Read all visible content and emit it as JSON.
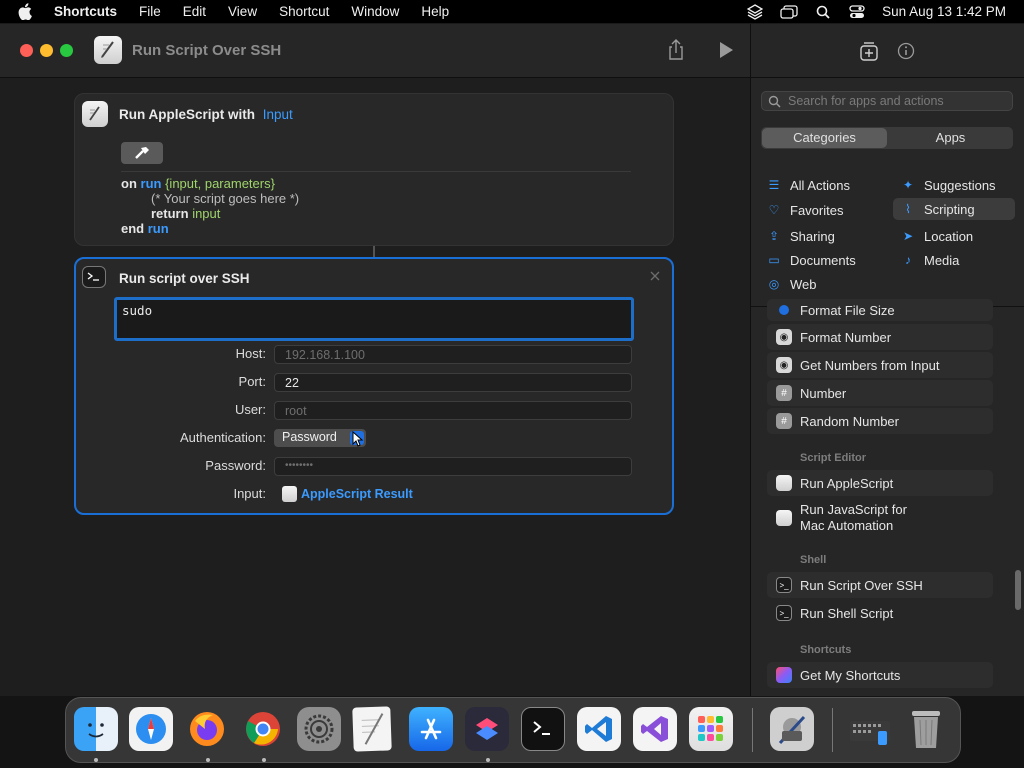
{
  "menubar": {
    "app": "Shortcuts",
    "items": [
      "File",
      "Edit",
      "View",
      "Shortcut",
      "Window",
      "Help"
    ],
    "clock": "Sun Aug 13  1:42 PM"
  },
  "window": {
    "title": "Run Script Over SSH"
  },
  "card1": {
    "title": "Run AppleScript with",
    "token": "Input",
    "code": {
      "l1_on": "on",
      "l1_run": "run",
      "l1_args": "{input, parameters}",
      "l2": "(* Your script goes here *)",
      "l3_return": "return",
      "l3_input": "input",
      "l4_end": "end",
      "l4_run": "run"
    }
  },
  "card2": {
    "title": "Run script over SSH",
    "script": "sudo",
    "host_label": "Host:",
    "host_placeholder": "192.168.1.100",
    "port_label": "Port:",
    "port_value": "22",
    "user_label": "User:",
    "user_placeholder": "root",
    "auth_label": "Authentication:",
    "auth_value": "Password",
    "password_label": "Password:",
    "password_placeholder": "••••••••",
    "input_label": "Input:",
    "input_value": "AppleScript Result"
  },
  "sidebar": {
    "search_placeholder": "Search for apps and actions",
    "segments": [
      "Categories",
      "Apps"
    ],
    "categories": {
      "all_actions": "All Actions",
      "suggestions": "Suggestions",
      "favorites": "Favorites",
      "scripting": "Scripting",
      "sharing": "Sharing",
      "location": "Location",
      "documents": "Documents",
      "media": "Media",
      "web": "Web"
    },
    "actions": {
      "format_file_size": "Format File Size",
      "format_number": "Format Number",
      "get_numbers": "Get Numbers from Input",
      "number": "Number",
      "random_number": "Random Number",
      "section_script_editor": "Script Editor",
      "run_applescript": "Run AppleScript",
      "run_js_1": "Run JavaScript for",
      "run_js_2": "Mac Automation",
      "section_shell": "Shell",
      "run_ssh": "Run Script Over SSH",
      "run_shell": "Run Shell Script",
      "section_shortcuts": "Shortcuts",
      "get_my_shortcuts": "Get My Shortcuts"
    }
  }
}
